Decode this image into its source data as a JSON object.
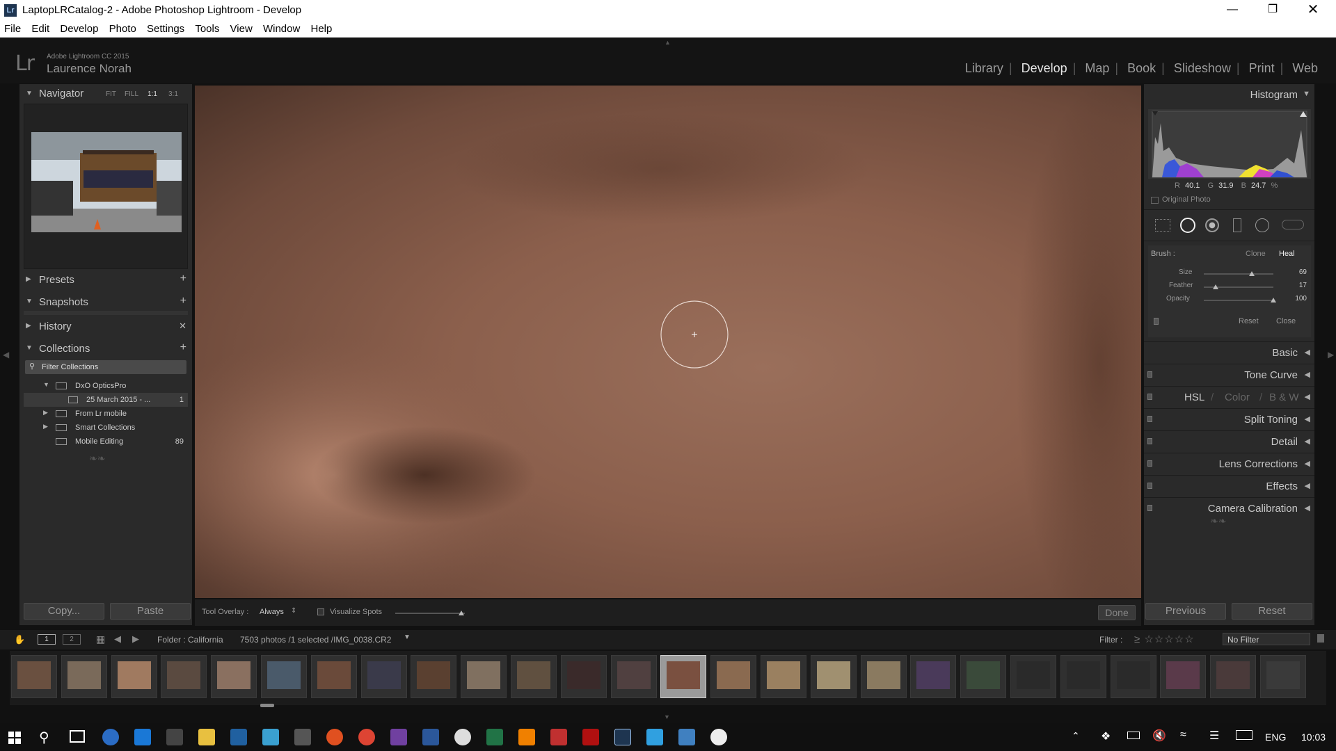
{
  "window": {
    "title": "LaptopLRCatalog-2 - Adobe Photoshop Lightroom - Develop",
    "app_icon": "Lr"
  },
  "menu": [
    "File",
    "Edit",
    "Develop",
    "Photo",
    "Settings",
    "Tools",
    "View",
    "Window",
    "Help"
  ],
  "identity": {
    "logo": "Lr",
    "version": "Adobe Lightroom CC 2015",
    "user": "Laurence Norah"
  },
  "modules": [
    {
      "label": "Library",
      "active": false
    },
    {
      "label": "Develop",
      "active": true
    },
    {
      "label": "Map",
      "active": false
    },
    {
      "label": "Book",
      "active": false
    },
    {
      "label": "Slideshow",
      "active": false
    },
    {
      "label": "Print",
      "active": false
    },
    {
      "label": "Web",
      "active": false
    }
  ],
  "navigator": {
    "title": "Navigator",
    "zoom": [
      "FIT",
      "FILL",
      "1:1",
      "3:1"
    ]
  },
  "left_panels": {
    "presets": "Presets",
    "snapshots": "Snapshots",
    "history": "History",
    "collections": "Collections",
    "filter_placeholder": "Filter Collections"
  },
  "collections": [
    {
      "label": "DxO OpticsPro",
      "count": ""
    },
    {
      "label": "25 March 2015 - ...",
      "count": "1"
    },
    {
      "label": "From Lr mobile",
      "count": ""
    },
    {
      "label": "Smart Collections",
      "count": ""
    },
    {
      "label": "Mobile Editing",
      "count": "89"
    }
  ],
  "left_buttons": {
    "copy": "Copy...",
    "paste": "Paste"
  },
  "histogram": {
    "title": "Histogram",
    "r_label": "R",
    "r": "40.1",
    "g_label": "G",
    "g": "31.9",
    "b_label": "B",
    "b": "24.7",
    "unit": "%",
    "original": "Original Photo"
  },
  "spot_tool": {
    "brush_label": "Brush :",
    "clone": "Clone",
    "heal": "Heal",
    "sliders": [
      {
        "label": "Size",
        "value": "69",
        "fraction": 0.69
      },
      {
        "label": "Feather",
        "value": "17",
        "fraction": 0.17
      },
      {
        "label": "Opacity",
        "value": "100",
        "fraction": 1.0
      }
    ],
    "reset": "Reset",
    "close": "Close"
  },
  "right_panels": {
    "basic": "Basic",
    "tone_curve": "Tone Curve",
    "hsl": "HSL",
    "color": "Color",
    "bw": "B & W",
    "split_toning": "Split Toning",
    "detail": "Detail",
    "lens": "Lens Corrections",
    "effects": "Effects",
    "calibration": "Camera Calibration"
  },
  "right_buttons": {
    "previous": "Previous",
    "reset": "Reset"
  },
  "toolbar": {
    "overlay_label": "Tool Overlay :",
    "overlay_value": "Always",
    "visualize": "Visualize Spots",
    "done": "Done"
  },
  "filmbar": {
    "folder": "Folder : California",
    "info": "7503 photos /1 selected /IMG_0038.CR2",
    "filter_label": "Filter :",
    "filter_value": "No Filter",
    "view1": "1",
    "view2": "2"
  },
  "filmstrip": {
    "count": 26,
    "selected_index": 13
  },
  "taskbar": {
    "lang": "ENG",
    "time": "10:03"
  },
  "colors": {
    "panel": "#2a2a2a",
    "bg": "#111111",
    "accent": "#e6e6e6"
  }
}
